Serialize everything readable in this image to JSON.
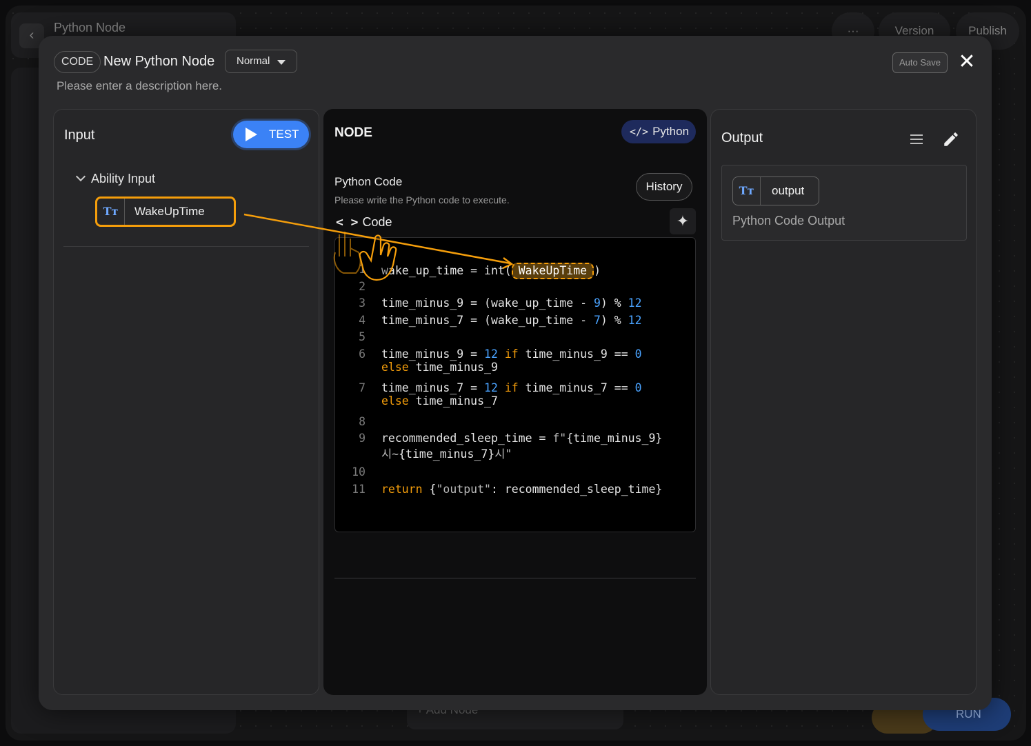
{
  "background": {
    "app_title": "Python Node",
    "more_label": "···",
    "version_label": "Version",
    "publish_label": "Publish",
    "add_node_label": "+ Add Node",
    "run_test_label": "RUN TEST"
  },
  "header": {
    "code_badge": "CODE",
    "title": "New Python Node",
    "mode": "Normal",
    "description_placeholder": "Please enter a description here.",
    "autosave_label": "Auto Save",
    "close_symbol": "✕"
  },
  "input_panel": {
    "title": "Input",
    "test_label": "TEST",
    "group_label": "Ability Input",
    "variable": {
      "type_icon": "Tт",
      "name": "WakeUpTime"
    }
  },
  "node_panel": {
    "title": "NODE",
    "language": "Python",
    "language_icon": "</>",
    "section_title": "Python Code",
    "section_hint": "Please write the Python code to execute.",
    "history_label": "History",
    "code_label": "Code",
    "code_icon": "< >",
    "sparkle_icon": "✦",
    "code_lines": [
      {
        "n": "1",
        "text": "wake_up_time = int(WakeUpTime)"
      },
      {
        "n": "2",
        "text": ""
      },
      {
        "n": "3",
        "text": "time_minus_9 = (wake_up_time - 9) % 12"
      },
      {
        "n": "4",
        "text": "time_minus_7 = (wake_up_time - 7) % 12"
      },
      {
        "n": "5",
        "text": ""
      },
      {
        "n": "6",
        "text": "time_minus_9 = 12 if time_minus_9 == 0 else time_minus_9"
      },
      {
        "n": "7",
        "text": "time_minus_7 = 12 if time_minus_7 == 0 else time_minus_7"
      },
      {
        "n": "8",
        "text": ""
      },
      {
        "n": "9",
        "text": "recommended_sleep_time = f\"{time_minus_9}시~{time_minus_7}시\""
      },
      {
        "n": "10",
        "text": ""
      },
      {
        "n": "11",
        "text": "return {\"output\": recommended_sleep_time}"
      }
    ],
    "inline_variable": "WakeUpTime"
  },
  "output_panel": {
    "title": "Output",
    "variable": {
      "type_icon": "Tт",
      "name": "output"
    },
    "description": "Python Code Output"
  },
  "colors": {
    "accent_blue": "#3b82f6",
    "accent_orange": "#f59e0b",
    "python_badge": "#1e2a5c"
  },
  "icons": [
    "back-arrow-icon",
    "play-icon",
    "chevron-down-icon",
    "text-type-icon",
    "code-icon",
    "sparkle-icon",
    "menu-icon",
    "pencil-icon",
    "close-icon",
    "hand-pointer-icon"
  ]
}
